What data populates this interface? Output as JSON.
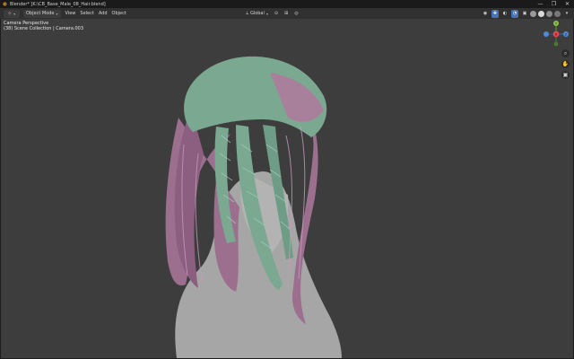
{
  "window": {
    "title": "Blender* [K:\\CB_Base_Male_08_Hair.blend]",
    "controls": [
      "—",
      "❐",
      "✕"
    ]
  },
  "header": {
    "editor_icon": "⊹",
    "mode": "Object Mode",
    "menu": [
      "View",
      "Select",
      "Add",
      "Object"
    ],
    "transform_orientation": "Global",
    "pivot_icon": "⊙",
    "snap_icon": "⊞",
    "proportional_icon": "◎"
  },
  "viewport": {
    "view_name": "Camera Perspective",
    "collection_line": "(38) Scene Collection | Camera.003"
  },
  "gizmo": {
    "x_label": "X",
    "y_label": "Y",
    "z_label": "Z"
  },
  "nav_icons": [
    "zoom-icon",
    "hand-pan-icon",
    "camera-icon"
  ],
  "colors": {
    "viewport_bg": "#3d3d3d",
    "header_bg": "#303030",
    "accent_blue": "#4772b3",
    "hair_pink": "#9c6f8f",
    "hair_green": "#7aa891",
    "body_gray": "#a6a6a6"
  }
}
